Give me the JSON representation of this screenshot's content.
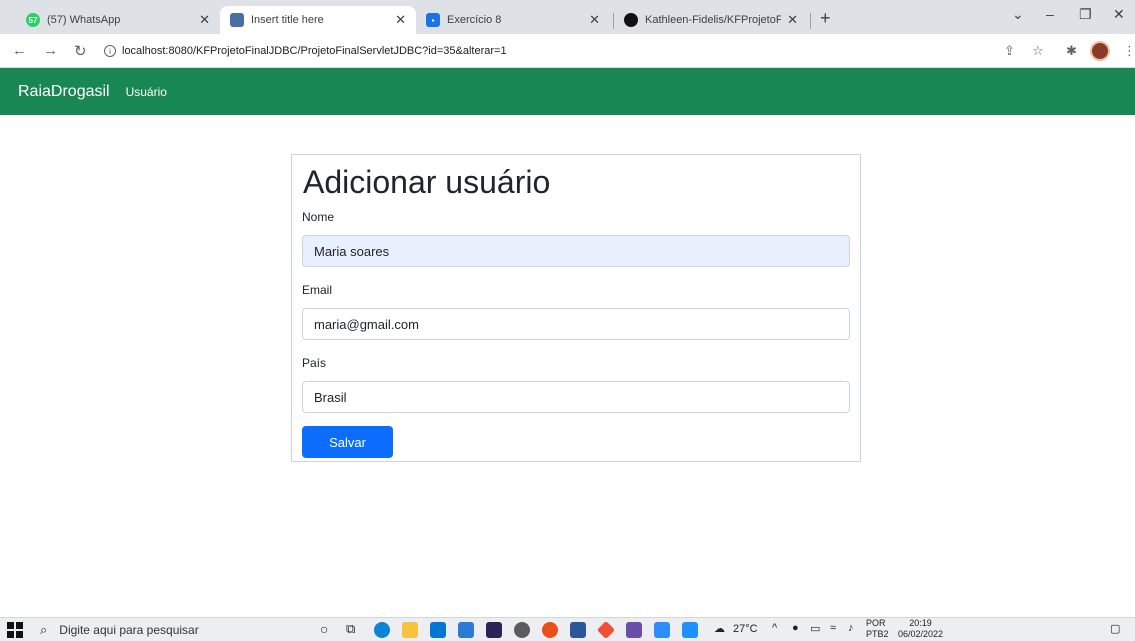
{
  "browser": {
    "tabs": [
      {
        "title": "(57) WhatsApp",
        "favicon": "whatsapp-icon",
        "badge": "57",
        "color": "#25d366",
        "active": false
      },
      {
        "title": "Insert title here",
        "favicon": "page-icon",
        "color": "#4a6fa5",
        "active": true
      },
      {
        "title": "Exercício 8",
        "favicon": "classroom-icon",
        "color": "#1a73e8",
        "active": false
      },
      {
        "title": "Kathleen-Fidelis/KFProjetoFinalJD",
        "favicon": "github-icon",
        "color": "#111111",
        "active": false
      }
    ],
    "url": "localhost:8080/KFProjetoFinalJDBC/ProjetoFinalServletJDBC?id=35&alterar=1"
  },
  "navbar": {
    "brand": "RaiaDrogasil",
    "link": "Usuário",
    "color": "#198754"
  },
  "form": {
    "title": "Adicionar usuário",
    "fields": [
      {
        "label": "Nome",
        "value": "Maria soares"
      },
      {
        "label": "Email",
        "value": "maria@gmail.com"
      },
      {
        "label": "País",
        "value": "Brasil"
      }
    ],
    "submit_label": "Salvar",
    "submit_color": "#0d6efd"
  },
  "taskbar": {
    "search_placeholder": "Digite aqui para pesquisar",
    "weather": "27°C",
    "language": "POR",
    "layout": "PTB2",
    "time": "20:19",
    "date": "06/02/2022"
  }
}
